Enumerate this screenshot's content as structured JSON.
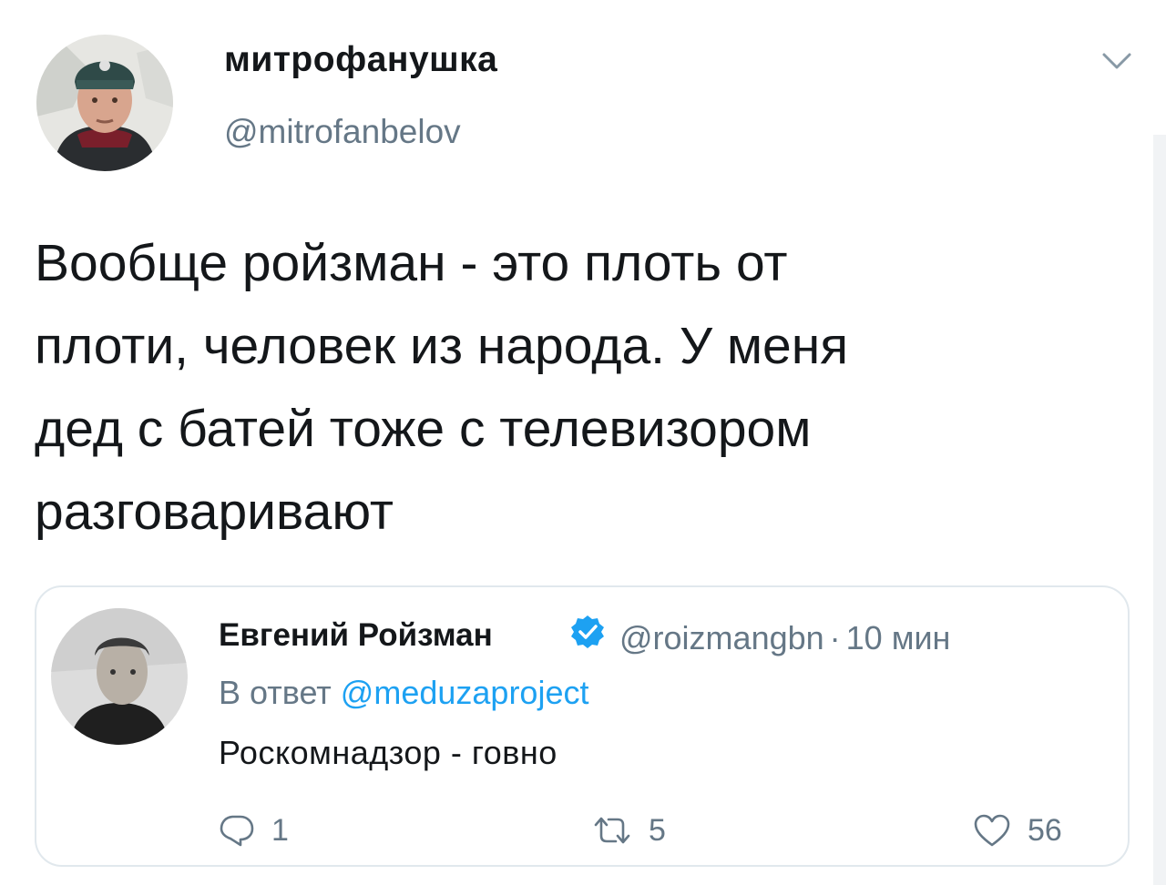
{
  "tweet": {
    "author": {
      "display_name": "митрофанушка",
      "handle": "@mitrofanbelov",
      "avatar_icon": "user-avatar-photo"
    },
    "text": "Вообще ройзман - это плоть от\nплоти, человек из народа. У меня\nдед с батей тоже с телевизором\nразговаривают",
    "menu_icon": "chevron-down-icon"
  },
  "quoted_tweet": {
    "author": {
      "display_name": "Евгений Ройзман",
      "verified_icon": "verified-badge-icon",
      "handle": "@roizmangbn",
      "separator": "·",
      "time": "10 мин",
      "avatar_icon": "user-avatar-photo"
    },
    "reply_prefix": "В ответ",
    "reply_to": "@meduzaproject",
    "text": "Роскомнадзор - говно",
    "actions": {
      "reply": {
        "icon": "reply-icon",
        "count": "1"
      },
      "retweet": {
        "icon": "retweet-icon",
        "count": "5"
      },
      "like": {
        "icon": "heart-icon",
        "count": "56"
      }
    }
  },
  "colors": {
    "text": "#14171a",
    "secondary": "#657786",
    "link": "#1da1f2",
    "border": "#e1e8ed"
  }
}
